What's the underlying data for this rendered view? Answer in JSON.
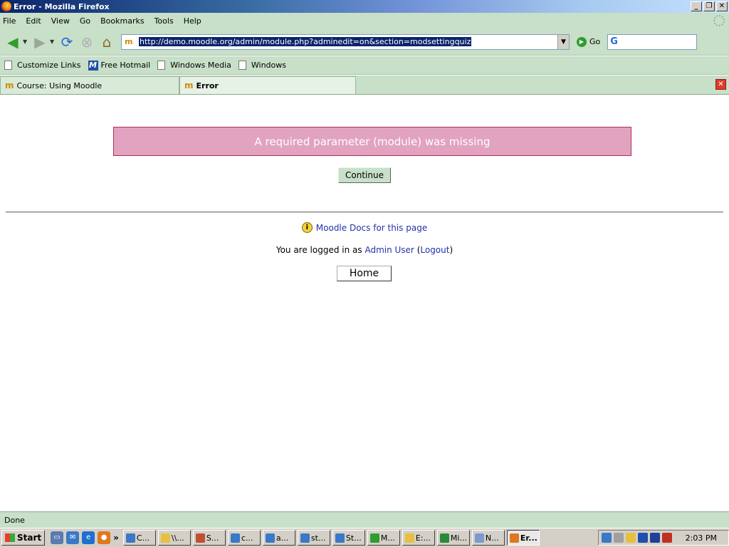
{
  "window": {
    "title": "Error - Mozilla Firefox"
  },
  "menu": [
    "File",
    "Edit",
    "View",
    "Go",
    "Bookmarks",
    "Tools",
    "Help"
  ],
  "toolbar": {
    "url": "http://demo.moodle.org/admin/module.php?adminedit=on&section=modsettingquiz",
    "go_label": "Go",
    "search_engine_icon": "G"
  },
  "bookmarks": [
    "Customize Links",
    "Free Hotmail",
    "Windows Media",
    "Windows"
  ],
  "tabs": [
    {
      "label": "Course: Using Moodle"
    },
    {
      "label": "Error"
    }
  ],
  "page": {
    "error_message": "A required parameter (module) was missing",
    "continue_label": "Continue",
    "docs_link": "Moodle Docs for this page",
    "login_prefix": "You are logged in as ",
    "login_user": "Admin User",
    "login_open": " (",
    "logout_label": "Logout",
    "login_close": ")",
    "home_label": "Home"
  },
  "status": {
    "text": "Done"
  },
  "taskbar": {
    "start_label": "Start",
    "tasks": [
      "C...",
      "\\\\...",
      "S...",
      "c...",
      "a...",
      "st...",
      "St...",
      "M...",
      "E:...",
      "Mi...",
      "N...",
      "Er..."
    ],
    "clock": "2:03 PM"
  },
  "colors": {
    "chrome": "#c8dfc8",
    "error_bg": "#e1a3c0",
    "error_border": "#b03050",
    "link": "#2232a8",
    "url_highlight": "#0a246a"
  }
}
